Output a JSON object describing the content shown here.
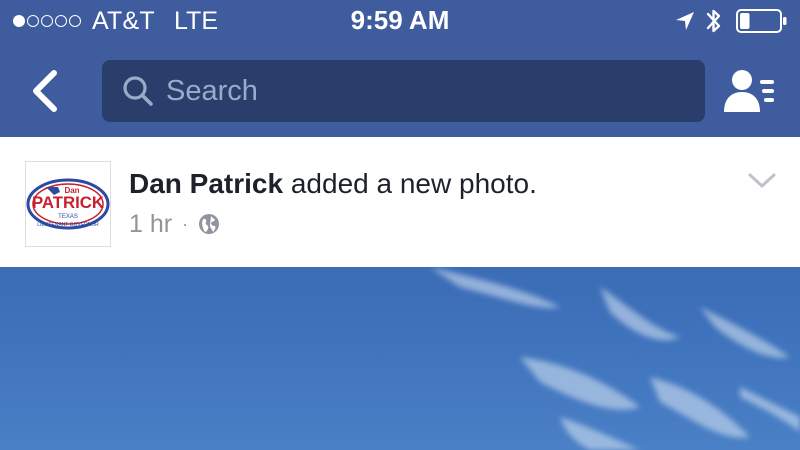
{
  "status_bar": {
    "signal_bars_total": 5,
    "signal_bars_filled": 1,
    "carrier": "AT&T",
    "network": "LTE",
    "time": "9:59 AM",
    "battery_level": 0.25
  },
  "nav": {
    "back_icon": "chevron-left-icon",
    "search_icon": "search-icon",
    "search_placeholder": "Search",
    "friends_icon": "friend-requests-icon"
  },
  "post": {
    "author": "Dan Patrick",
    "action": " added a new photo.",
    "timestamp": "1 hr",
    "separator": "·",
    "privacy_icon": "globe-icon",
    "menu_icon": "chevron-down-icon",
    "avatar": {
      "logo_top": "Dan",
      "logo_name": "PATRICK",
      "logo_state": "TEXAS",
      "logo_office": "LIEUTENANT GOVERNOR"
    }
  },
  "colors": {
    "header_bg": "#3f5c9e",
    "search_bg": "#293e6b",
    "card_bg": "#ffffff",
    "author_text": "#1d2129",
    "meta_text": "#90949c",
    "sky": "#3f73bc"
  }
}
